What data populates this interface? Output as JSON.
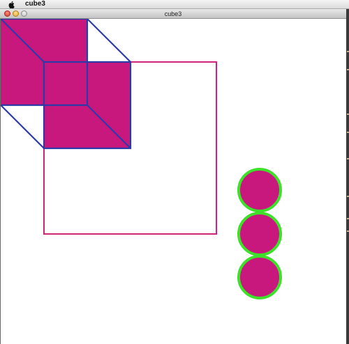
{
  "menubar": {
    "apple_icon": "apple-logo",
    "app_name": "cube3"
  },
  "window": {
    "title": "cube3",
    "buttons": [
      "close",
      "minimize",
      "zoom"
    ]
  },
  "sketch": {
    "fill_color": "#c8187d",
    "cube_edge_color": "#2b3aa8",
    "outline_square_color": "#d0237e",
    "circle_stroke_color": "#3ee02a",
    "circle_count": 3
  }
}
